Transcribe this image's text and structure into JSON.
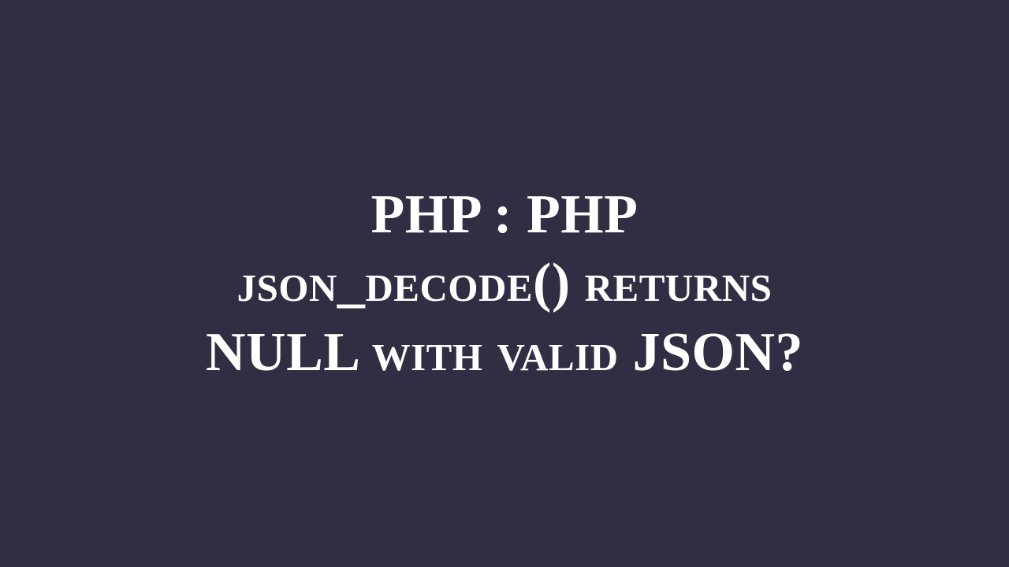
{
  "title": {
    "line1": "PHP : PHP",
    "line2": "json_decode() returns",
    "line3": "NULL with valid JSON?"
  },
  "colors": {
    "background": "#2f2e43",
    "text": "#ffffff"
  }
}
